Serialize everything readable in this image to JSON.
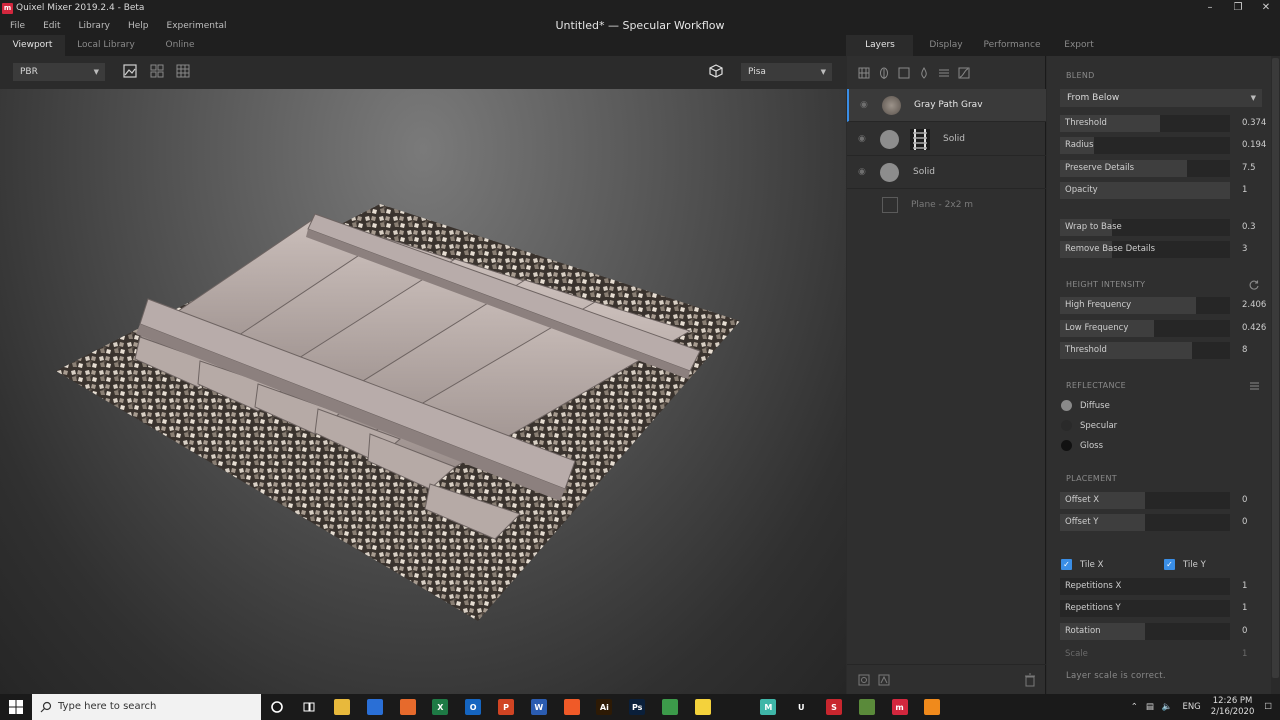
{
  "window": {
    "app_title": "Quixel Mixer 2019.2.4 - Beta",
    "doc_title": "Untitled* — Specular Workflow"
  },
  "menu": [
    "File",
    "Edit",
    "Library",
    "Help",
    "Experimental"
  ],
  "left_tabs": [
    {
      "label": "Viewport",
      "active": true
    },
    {
      "label": "Local Library",
      "active": false
    },
    {
      "label": "Online",
      "active": false
    }
  ],
  "viewport_toolbar": {
    "render_mode": "PBR",
    "environment": "Pisa"
  },
  "right_tabs": [
    {
      "label": "Layers",
      "active": true
    },
    {
      "label": "Display",
      "active": false
    },
    {
      "label": "Performance",
      "active": false
    },
    {
      "label": "Export",
      "active": false
    }
  ],
  "layers": [
    {
      "name": "Gray Path Grav",
      "selected": true,
      "thumb": "gravel-thumb"
    },
    {
      "name": "Solid",
      "selected": false,
      "thumb": "rail-mask-thumb"
    },
    {
      "name": "Solid",
      "selected": false,
      "thumb": "solid-thumb"
    },
    {
      "name": "Plane - 2x2 m",
      "selected": false,
      "thumb": "plane-thumb"
    }
  ],
  "blend": {
    "header": "BLEND",
    "mode": "From Below",
    "rows": [
      {
        "label": "Threshold",
        "value": "0.374",
        "fill": 0.374
      },
      {
        "label": "Radius",
        "value": "0.194",
        "fill": 0.194
      },
      {
        "label": "Preserve Details",
        "value": "7.5",
        "fill": 0.75
      },
      {
        "label": "Opacity",
        "value": "1",
        "fill": 1.0
      },
      {
        "label": "Wrap to Base",
        "value": "0.3",
        "fill": 0.3
      },
      {
        "label": "Remove Base Details",
        "value": "3",
        "fill": 0.3
      }
    ]
  },
  "height_intensity": {
    "header": "HEIGHT INTENSITY",
    "rows": [
      {
        "label": "High Frequency",
        "value": "2.406",
        "fill": 0.8
      },
      {
        "label": "Low Frequency",
        "value": "0.426",
        "fill": 0.55
      },
      {
        "label": "Threshold",
        "value": "8",
        "fill": 0.78
      }
    ]
  },
  "reflectance": {
    "header": "REFLECTANCE",
    "items": [
      {
        "label": "Diffuse",
        "color": "#8a8a8a"
      },
      {
        "label": "Specular",
        "color": "#2a2a2a"
      },
      {
        "label": "Gloss",
        "color": "#111111"
      }
    ]
  },
  "placement": {
    "header": "PLACEMENT",
    "offsets": [
      {
        "label": "Offset X",
        "value": "0",
        "fill": 0.5
      },
      {
        "label": "Offset Y",
        "value": "0",
        "fill": 0.5
      }
    ],
    "tile_x": "Tile X",
    "tile_y": "Tile Y",
    "repeats": [
      {
        "label": "Repetitions X",
        "value": "1"
      },
      {
        "label": "Repetitions Y",
        "value": "1"
      },
      {
        "label": "Rotation",
        "value": "0"
      }
    ],
    "scale_label": "Scale",
    "scale_value": "1",
    "scale_status": "Layer scale is correct."
  },
  "taskbar": {
    "search_placeholder": "Type here to search",
    "lang": "ENG",
    "time": "12:26 PM",
    "date": "2/16/2020",
    "apps": [
      {
        "name": "file-explorer-icon",
        "color": "#e8b93c",
        "glyph": ""
      },
      {
        "name": "store-icon",
        "color": "#2a6fd6",
        "glyph": ""
      },
      {
        "name": "firefox-icon",
        "color": "#e66a2c",
        "glyph": ""
      },
      {
        "name": "excel-icon",
        "color": "#1e7a45",
        "glyph": "X"
      },
      {
        "name": "outlook-icon",
        "color": "#1565c0",
        "glyph": "O"
      },
      {
        "name": "powerpoint-icon",
        "color": "#d04423",
        "glyph": "P"
      },
      {
        "name": "word-icon",
        "color": "#2b5cb0",
        "glyph": "W"
      },
      {
        "name": "brave-icon",
        "color": "#f05a28",
        "glyph": ""
      },
      {
        "name": "illustrator-icon",
        "color": "#2d1a05",
        "glyph": "Ai"
      },
      {
        "name": "photoshop-icon",
        "color": "#0a1f3a",
        "glyph": "Ps"
      },
      {
        "name": "chrome-icon",
        "color": "#3c9a4a",
        "glyph": ""
      },
      {
        "name": "sticky-notes-icon",
        "color": "#f4d23c",
        "glyph": ""
      },
      {
        "name": "blender-icon",
        "color": "#1a1a1a",
        "glyph": ""
      },
      {
        "name": "megascans-icon",
        "color": "#3fb6a8",
        "glyph": "M"
      },
      {
        "name": "unreal-icon",
        "color": "#1a1a1a",
        "glyph": "U"
      },
      {
        "name": "substance-icon",
        "color": "#c8262e",
        "glyph": "S"
      },
      {
        "name": "minecraft-icon",
        "color": "#5a8a3a",
        "glyph": ""
      },
      {
        "name": "mixer-taskbar-icon",
        "color": "#d3273e",
        "glyph": "m"
      },
      {
        "name": "vlc-icon",
        "color": "#f08a1c",
        "glyph": ""
      }
    ]
  }
}
